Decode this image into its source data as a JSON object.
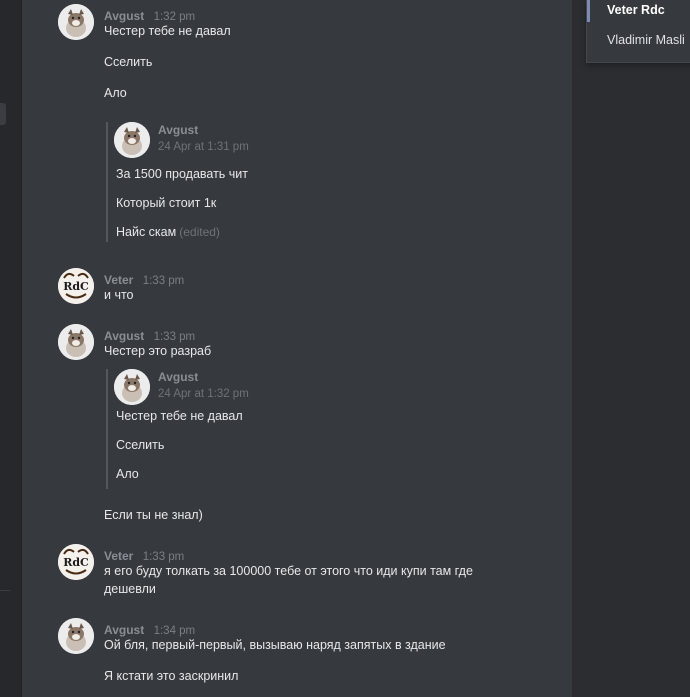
{
  "right_panel": {
    "items": [
      {
        "label": "Veter Rdc",
        "active": true
      },
      {
        "label": "Vladimir Masli",
        "active": false
      }
    ]
  },
  "messages": [
    {
      "author": "Avgust",
      "time": "1:32 pm",
      "avatar": "dog-avatar",
      "lines": [
        "Честер тебе не давал",
        "Сселить",
        "Ало"
      ],
      "quote": {
        "author": "Avgust",
        "time": "24 Apr at 1:31 pm",
        "lines": [
          "За 1500 продавать чит",
          "Который стоит 1к",
          "Найс скам"
        ],
        "edited": "(edited)"
      }
    },
    {
      "author": "Veter",
      "time": "1:33 pm",
      "avatar": "rdc-avatar",
      "lines": [
        "и что"
      ]
    },
    {
      "author": "Avgust",
      "time": "1:33 pm",
      "avatar": "dog-avatar",
      "lines": [
        "Честер это разраб"
      ],
      "quote": {
        "author": "Avgust",
        "time": "24 Apr at 1:32 pm",
        "lines": [
          "Честер тебе не давал",
          "Сселить",
          "Ало"
        ]
      },
      "after_quote": [
        "Если ты не знал)"
      ]
    },
    {
      "author": "Veter",
      "time": "1:33 pm",
      "avatar": "rdc-avatar",
      "lines": [
        "я его буду толкать за 100000 тебе от этого что иди купи там где дешевли"
      ]
    },
    {
      "author": "Avgust",
      "time": "1:34 pm",
      "avatar": "dog-avatar",
      "lines": [
        "Ой бля, первый-первый, вызываю наряд запятых в здание",
        "Я кстати это заскринил"
      ]
    }
  ]
}
